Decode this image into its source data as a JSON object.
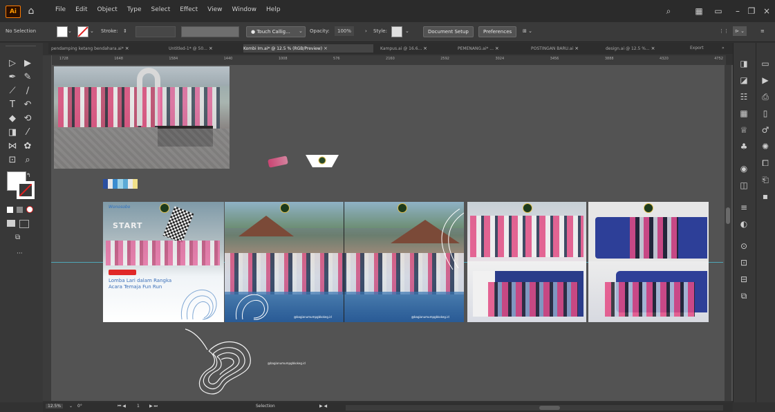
{
  "menu": {
    "items": [
      "File",
      "Edit",
      "Object",
      "Type",
      "Select",
      "Effect",
      "View",
      "Window",
      "Help"
    ]
  },
  "app": {
    "logo_text": "Ai"
  },
  "controlbar": {
    "selection": "No Selection",
    "stroke_label": "Stroke:",
    "brush": "Touch Callig...",
    "opacity_label": "Opacity:",
    "opacity_value": "100%",
    "style_label": "Style:",
    "doc_setup": "Document Setup",
    "preferences": "Preferences"
  },
  "tabs": [
    {
      "label": "pendamping ketang bendahara.ai*",
      "active": false
    },
    {
      "label": "Untitled-1* @ 50...",
      "active": false
    },
    {
      "label": "Kombi Im.ai* @ 12.5 % (RGB/Preview)",
      "active": true
    },
    {
      "label": "Kampus.ai @ 16.6...",
      "active": false
    },
    {
      "label": "PEMENANG.ai* ...",
      "active": false
    },
    {
      "label": "POSTINGAN BARU.ai",
      "active": false
    },
    {
      "label": "design.ai @ 12.5 %...",
      "active": false
    },
    {
      "label": "Export",
      "active": false
    }
  ],
  "ruler": {
    "ticks": [
      "1728",
      "1648",
      "1584",
      "1440",
      "1008",
      "576",
      "2160",
      "2592",
      "3024",
      "3456",
      "3888",
      "4320",
      "4752"
    ]
  },
  "artwork": {
    "slide1_title": "START",
    "slide1_badge": "Wonosobo",
    "slide1_text": "Lomba Lari dalam Rangka Acara Temaja Fun Run",
    "watermark": "@bagianumumpgbkokeg.id"
  },
  "status": {
    "zoom": "12.5%",
    "rotation": "0°",
    "artboard": "1",
    "mode": "Selection"
  },
  "colors": {
    "canvas": "#535353",
    "panel": "#383838",
    "accent": "#ff7c00"
  }
}
